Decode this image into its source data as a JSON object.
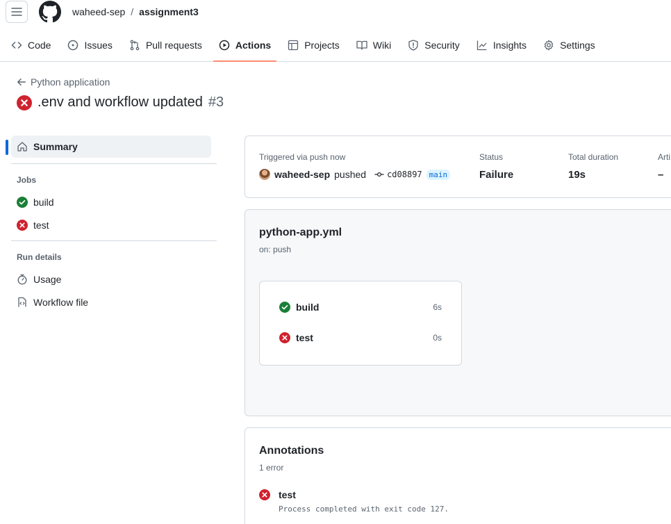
{
  "header": {
    "owner": "waheed-sep",
    "separator": "/",
    "repo": "assignment3"
  },
  "nav": {
    "tabs": [
      {
        "label": "Code",
        "icon": "code-icon"
      },
      {
        "label": "Issues",
        "icon": "issue-opened-icon"
      },
      {
        "label": "Pull requests",
        "icon": "git-pull-request-icon"
      },
      {
        "label": "Actions",
        "icon": "play-icon",
        "selected": true
      },
      {
        "label": "Projects",
        "icon": "table-icon"
      },
      {
        "label": "Wiki",
        "icon": "book-icon"
      },
      {
        "label": "Security",
        "icon": "shield-icon"
      },
      {
        "label": "Insights",
        "icon": "graph-icon"
      },
      {
        "label": "Settings",
        "icon": "gear-icon"
      }
    ]
  },
  "run": {
    "back_label": "Python application",
    "title": ".env and workflow updated",
    "number": "#3"
  },
  "sidebar": {
    "summary_label": "Summary",
    "jobs_heading": "Jobs",
    "jobs": [
      {
        "label": "build",
        "status": "success"
      },
      {
        "label": "test",
        "status": "failure"
      }
    ],
    "details_heading": "Run details",
    "details": [
      {
        "label": "Usage",
        "icon": "stopwatch-icon"
      },
      {
        "label": "Workflow file",
        "icon": "file-code-icon"
      }
    ]
  },
  "summary": {
    "trigger_label": "Triggered via push now",
    "actor": "waheed-sep",
    "action": "pushed",
    "sha": "cd08897",
    "branch": "main",
    "status_label": "Status",
    "status_value": "Failure",
    "duration_label": "Total duration",
    "duration_value": "19s",
    "artifacts_label": "Arti",
    "artifacts_value": "–"
  },
  "workflow": {
    "file": "python-app.yml",
    "trigger": "on: push",
    "jobs": [
      {
        "label": "build",
        "duration": "6s",
        "status": "success"
      },
      {
        "label": "test",
        "duration": "0s",
        "status": "failure"
      }
    ]
  },
  "annotations": {
    "title": "Annotations",
    "count": "1 error",
    "items": [
      {
        "job": "test",
        "message": "Process completed with exit code 127."
      }
    ]
  },
  "colors": {
    "success": "#1a7f37",
    "failure": "#cf222e",
    "accent": "#0969da",
    "selected_underline": "#fd8c73"
  }
}
